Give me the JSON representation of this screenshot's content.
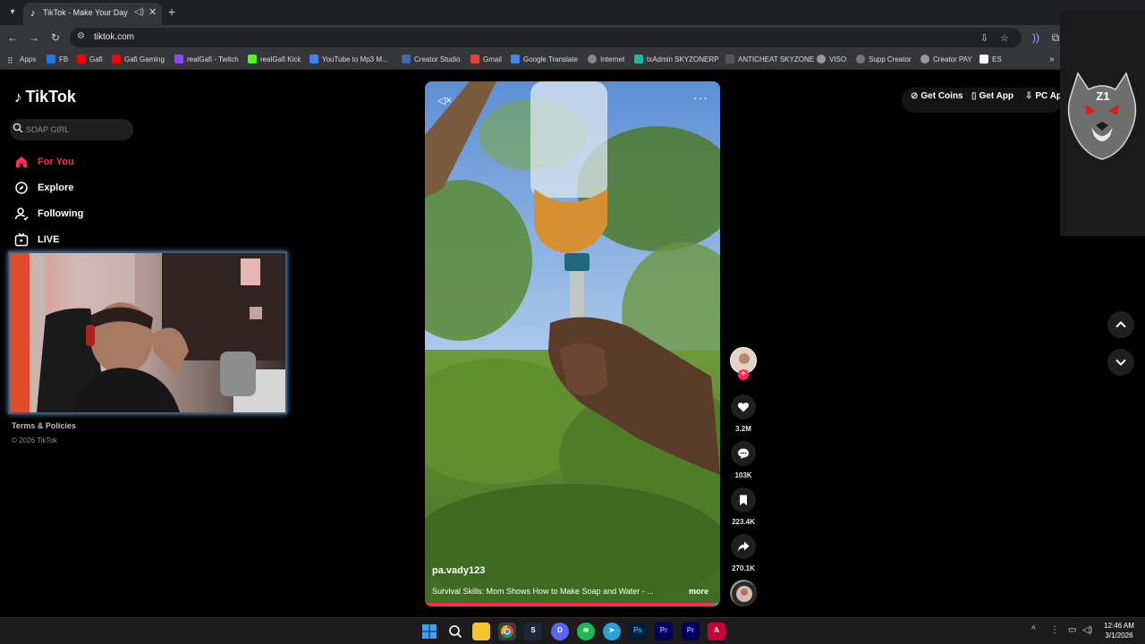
{
  "browser": {
    "tab_title": "TikTok - Make Your Day",
    "address": "tiktok.com",
    "bookmarks": [
      {
        "label": "Apps",
        "color": "#cccccc"
      },
      {
        "label": "FB",
        "color": "#1877f2"
      },
      {
        "label": "Gafi",
        "color": "#ff0000"
      },
      {
        "label": "Gafi Gaming",
        "color": "#ff0000"
      },
      {
        "label": "realGafi - Twitch",
        "color": "#9146ff"
      },
      {
        "label": "realGafi Kick",
        "color": "#53fc18"
      },
      {
        "label": "YouTube to Mp3 M...",
        "color": "#3b82f6"
      },
      {
        "label": "Creator Studio",
        "color": "#4267b2"
      },
      {
        "label": "Gmail",
        "color": "#ea4335"
      },
      {
        "label": "Google Translate",
        "color": "#4285f4"
      },
      {
        "label": "Internet",
        "color": "#888888"
      },
      {
        "label": "txAdmin SKYZONERP",
        "color": "#1abc9c"
      },
      {
        "label": "ANTICHEAT SKYZONE",
        "color": "#555555"
      },
      {
        "label": "VISO",
        "color": "#999999"
      },
      {
        "label": "Supp Creator",
        "color": "#777777"
      },
      {
        "label": "Creator PAY",
        "color": "#999999"
      },
      {
        "label": "ES",
        "color": "#ffffff"
      }
    ]
  },
  "tiktok": {
    "logo": "TikTok",
    "search_placeholder": "SOAP GIRL",
    "nav": [
      {
        "label": "For You",
        "icon": "home-icon",
        "active": true
      },
      {
        "label": "Explore",
        "icon": "compass-icon",
        "active": false
      },
      {
        "label": "Following",
        "icon": "following-icon",
        "active": false
      },
      {
        "label": "LIVE",
        "icon": "live-icon",
        "active": false
      }
    ],
    "footer": {
      "terms": "Terms & Policies",
      "copyright": "© 2026 TikTok"
    },
    "top_actions": {
      "coins": "Get Coins",
      "app": "Get App",
      "pc": "PC Ap"
    },
    "video": {
      "author": "pa.vady123",
      "caption": "Survival Skills: Mom Shows How to Make Soap and Water - ...",
      "more": "more",
      "progress": 0.98
    },
    "stats": {
      "likes": "3.2M",
      "comments": "103K",
      "saves": "223.4K",
      "shares": "270.1K"
    },
    "accent": "#fe2c55"
  },
  "overlay": {
    "badge": "Z1"
  },
  "taskbar": {
    "time": "12:46 AM",
    "date": "3/1/2026"
  }
}
